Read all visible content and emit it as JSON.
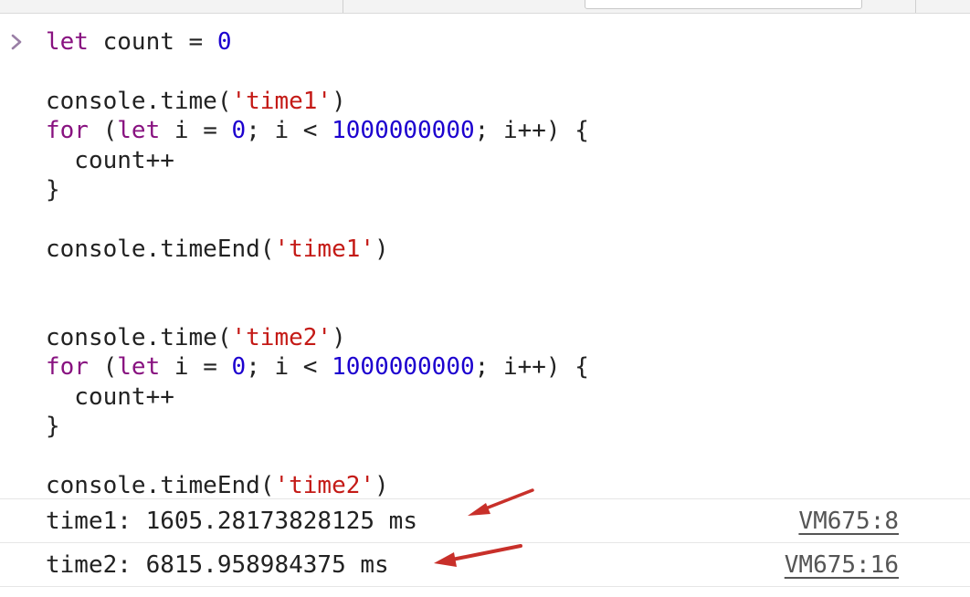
{
  "console": {
    "input_code": {
      "line1": {
        "kw1": "let",
        "t1": " count = ",
        "num1": "0"
      },
      "line3": {
        "t1": "console.time(",
        "str1": "'time1'",
        "t2": ")"
      },
      "line4": {
        "kw1": "for",
        "t1": " (",
        "kw2": "let",
        "t2": " i = ",
        "num1": "0",
        "t3": "; i < ",
        "num2": "1000000000",
        "t4": "; i++) {"
      },
      "line5": {
        "t1": "  count++"
      },
      "line6": {
        "t1": "}"
      },
      "line8": {
        "t1": "console.timeEnd(",
        "str1": "'time1'",
        "t2": ")"
      },
      "line11": {
        "t1": "console.time(",
        "str1": "'time2'",
        "t2": ")"
      },
      "line12": {
        "kw1": "for",
        "t1": " (",
        "kw2": "let",
        "t2": " i = ",
        "num1": "0",
        "t3": "; i < ",
        "num2": "1000000000",
        "t4": "; i++) {"
      },
      "line13": {
        "t1": "  count++"
      },
      "line14": {
        "t1": "}"
      },
      "line16": {
        "t1": "console.timeEnd(",
        "str1": "'time2'",
        "t2": ")"
      }
    },
    "output": [
      {
        "text": "time1: 1605.28173828125 ms",
        "source": "VM675:8"
      },
      {
        "text": "time2: 6815.958984375 ms",
        "source": "VM675:16"
      }
    ]
  },
  "colors": {
    "keyword": "#881280",
    "string": "#c41a16",
    "number": "#1c00cf",
    "annotation_arrow": "#c8302a"
  },
  "icons": {
    "prompt": "chevron-right-icon",
    "annotation": "red-arrow-icon"
  }
}
